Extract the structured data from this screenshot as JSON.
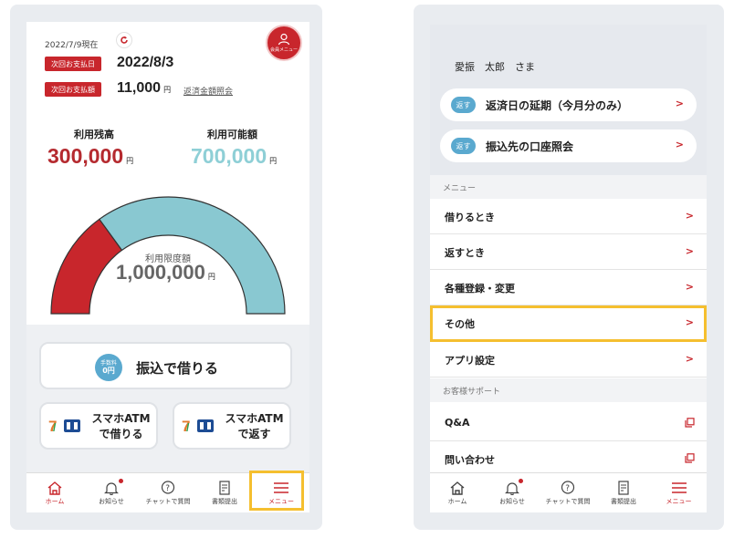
{
  "home": {
    "date_label": "2022/7/9現在",
    "main_menu_label": "会員メニュー",
    "next_due_tag": "次回お支払日",
    "next_due_date": "2022/8/3",
    "next_amount_tag": "次回お支払額",
    "next_amount": "11,000",
    "yen": "円",
    "repayment_link": "返済金額照会",
    "balance_label": "利用残高",
    "balance_value": "300,000",
    "available_label": "利用可能額",
    "available_value": "700,000",
    "limit_label": "利用限度額",
    "limit_value": "1,000,000",
    "usage_fraction": 0.3,
    "fee_badge_top": "手数料",
    "fee_badge_bottom": "0円",
    "transfer_borrow": "振込で借りる",
    "atm_borrow_line1": "スマホATM",
    "atm_borrow_line2": "で借りる",
    "atm_repay_line1": "スマホATM",
    "atm_repay_line2": "で返す"
  },
  "tabs": [
    {
      "label": "ホーム",
      "icon": "home-icon"
    },
    {
      "label": "お知らせ",
      "icon": "bell-icon"
    },
    {
      "label": "チャットで質問",
      "icon": "chat-question-icon"
    },
    {
      "label": "書類提出",
      "icon": "document-icon"
    },
    {
      "label": "メニュー",
      "icon": "hamburger-icon"
    }
  ],
  "menu": {
    "username": "愛振　太郎　さま",
    "badge": "返す",
    "shortcut_1": "返済日の延期（今月分のみ）",
    "shortcut_2": "振込先の口座照会",
    "section_menu": "メニュー",
    "items": [
      "借りるとき",
      "返すとき",
      "各種登録・変更",
      "その他",
      "アプリ設定"
    ],
    "section_support": "お客様サポート",
    "support_items": [
      "Q&A",
      "問い合わせ"
    ]
  },
  "colors": {
    "accent_red": "#c8262c",
    "gauge_red": "#c8262c",
    "gauge_blue": "#89c8d1",
    "balance_text": "#b52a2f",
    "available_text": "#8ecfd6",
    "highlight": "#f5bf2f",
    "badge_blue": "#5aa9cf"
  }
}
